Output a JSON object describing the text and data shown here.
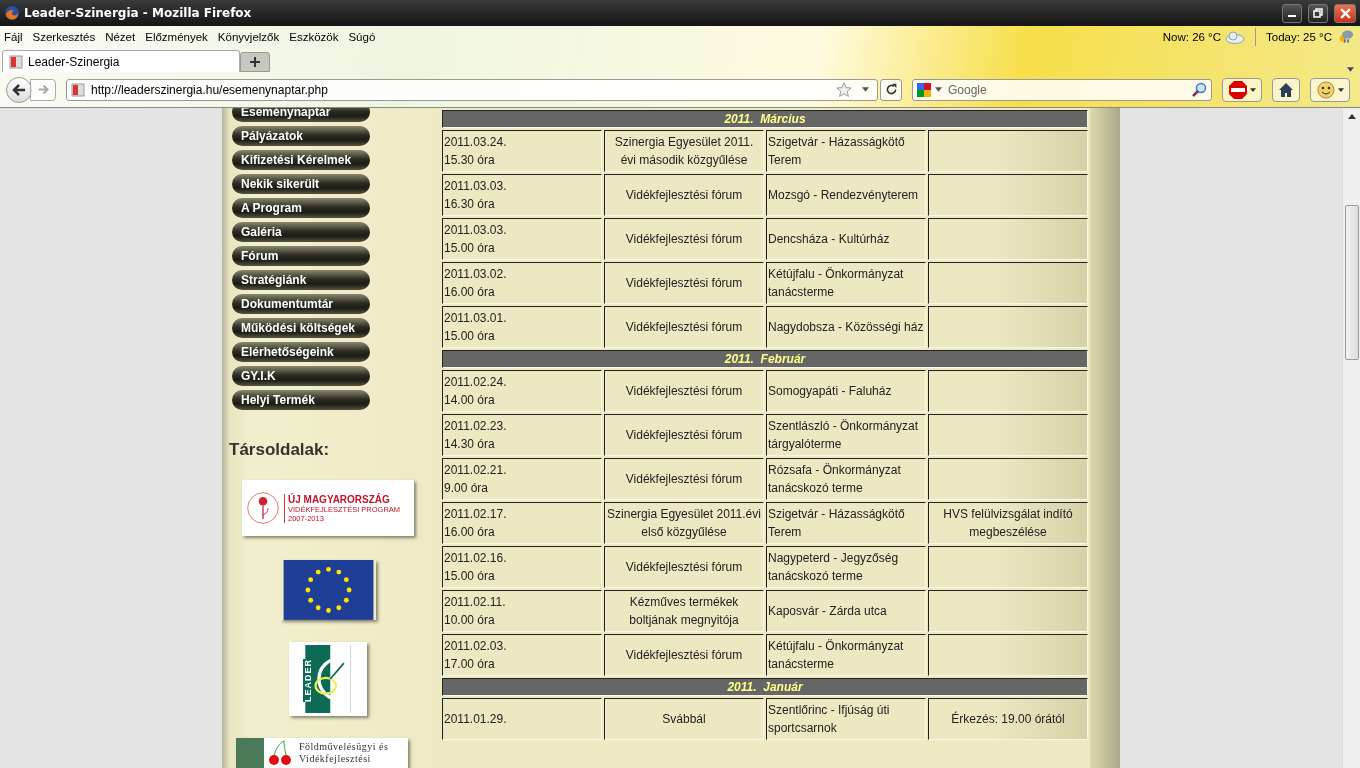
{
  "window": {
    "title": "Leader-Szinergia - Mozilla Firefox"
  },
  "menu": [
    "Fájl",
    "Szerkesztés",
    "Nézet",
    "Előzmények",
    "Könyvjelzők",
    "Eszközök",
    "Súgó"
  ],
  "weather": [
    {
      "label": "Now: 26 °C",
      "kind": "cloudy"
    },
    {
      "label": "Today: 25 °C",
      "kind": "rain"
    }
  ],
  "tabs": [
    {
      "label": "Leader-Szinergia",
      "selected": true
    }
  ],
  "address_bar": {
    "value": "http://leaderszinergia.hu/esemenynaptar.php"
  },
  "search": {
    "placeholder": "Google"
  },
  "sidebar": {
    "items": [
      "Eseménynaptár",
      "Pályázatok",
      "Kifizetési Kérelmek",
      "Nekik sikerült",
      "A Program",
      "Galéria",
      "Fórum",
      "Stratégiánk",
      "Dokumentumtár",
      "Működési költségek",
      "Elérhetőségeink",
      "GY.I.K",
      "Helyi Termék"
    ],
    "partners_heading": "Társoldalak:",
    "partners": [
      {
        "kind": "ujmo",
        "lines": [
          "ÚJ MAGYARORSZÁG",
          "VIDÉKFEJLESZTÉSI PROGRAM",
          "2007-2013"
        ]
      },
      {
        "kind": "eu"
      },
      {
        "kind": "leader",
        "lines": [
          "LEADER"
        ]
      },
      {
        "kind": "fvm",
        "lines": [
          "Földművelésügyi és",
          "Vidékfejlesztési"
        ]
      }
    ]
  },
  "calendar": [
    {
      "month": "2011.  Március",
      "events": [
        {
          "date": "2011.03.24.",
          "time": "15.30 óra",
          "title": "Szinergia Egyesület 2011. évi második közgyűlése",
          "place": "Szigetvár - Házasságkötő Terem"
        },
        {
          "date": "2011.03.03.",
          "time": "16.30 óra",
          "title": "Vidékfejlesztési fórum",
          "place": "Mozsgó - Rendezvényterem"
        },
        {
          "date": "2011.03.03.",
          "time": "15.00 óra",
          "title": "Vidékfejlesztési fórum",
          "place": "Dencsháza - Kultúrház"
        },
        {
          "date": "2011.03.02.",
          "time": "16.00 óra",
          "title": "Vidékfejlesztési fórum",
          "place": "Kétújfalu - Önkormányzat tanácsterme"
        },
        {
          "date": "2011.03.01.",
          "time": "15.00 óra",
          "title": "Vidékfejlesztési fórum",
          "place": "Nagydobsza - Közösségi ház"
        }
      ]
    },
    {
      "month": "2011.  Február",
      "events": [
        {
          "date": "2011.02.24.",
          "time": "14.00 óra",
          "title": "Vidékfejlesztési fórum",
          "place": "Somogyapáti - Faluház"
        },
        {
          "date": "2011.02.23.",
          "time": "14.30 óra",
          "title": "Vidékfejlesztési fórum",
          "place": "Szentlászló - Önkormányzat tárgyalóterme"
        },
        {
          "date": "2011.02.21.",
          "time": "9.00 óra",
          "title": "Vidékfejlesztési fórum",
          "place": "Rózsafa - Önkormányzat tanácskozó terme"
        },
        {
          "date": "2011.02.17.",
          "time": "16.00 óra",
          "title": "Szinergia Egyesület 2011.évi első közgyűlése",
          "place": "Szigetvár - Házasságkötő Terem",
          "note": "HVS felülvizsgálat indító megbeszélése"
        },
        {
          "date": "2011.02.16.",
          "time": "15.00 óra",
          "title": "Vidékfejlesztési fórum",
          "place": "Nagypeterd - Jegyzőség tanácskozó terme"
        },
        {
          "date": "2011.02.11.",
          "time": "10.00 óra",
          "title": "Kézműves termékek boltjának megnyitója",
          "place": "Kaposvár - Zárda utca"
        },
        {
          "date": "2011.02.03.",
          "time": "17.00 óra",
          "title": "Vidékfejlesztési fórum",
          "place": "Kétújfalu - Önkormányzat tanácsterme"
        }
      ]
    },
    {
      "month": "2011.  Január",
      "events": [
        {
          "date": "2011.01.29.",
          "title": "Svábbál",
          "place": "Szentlőrinc - Ifjúság úti sportcsarnok",
          "note": "Érkezés: 19.00 órától"
        }
      ]
    }
  ]
}
